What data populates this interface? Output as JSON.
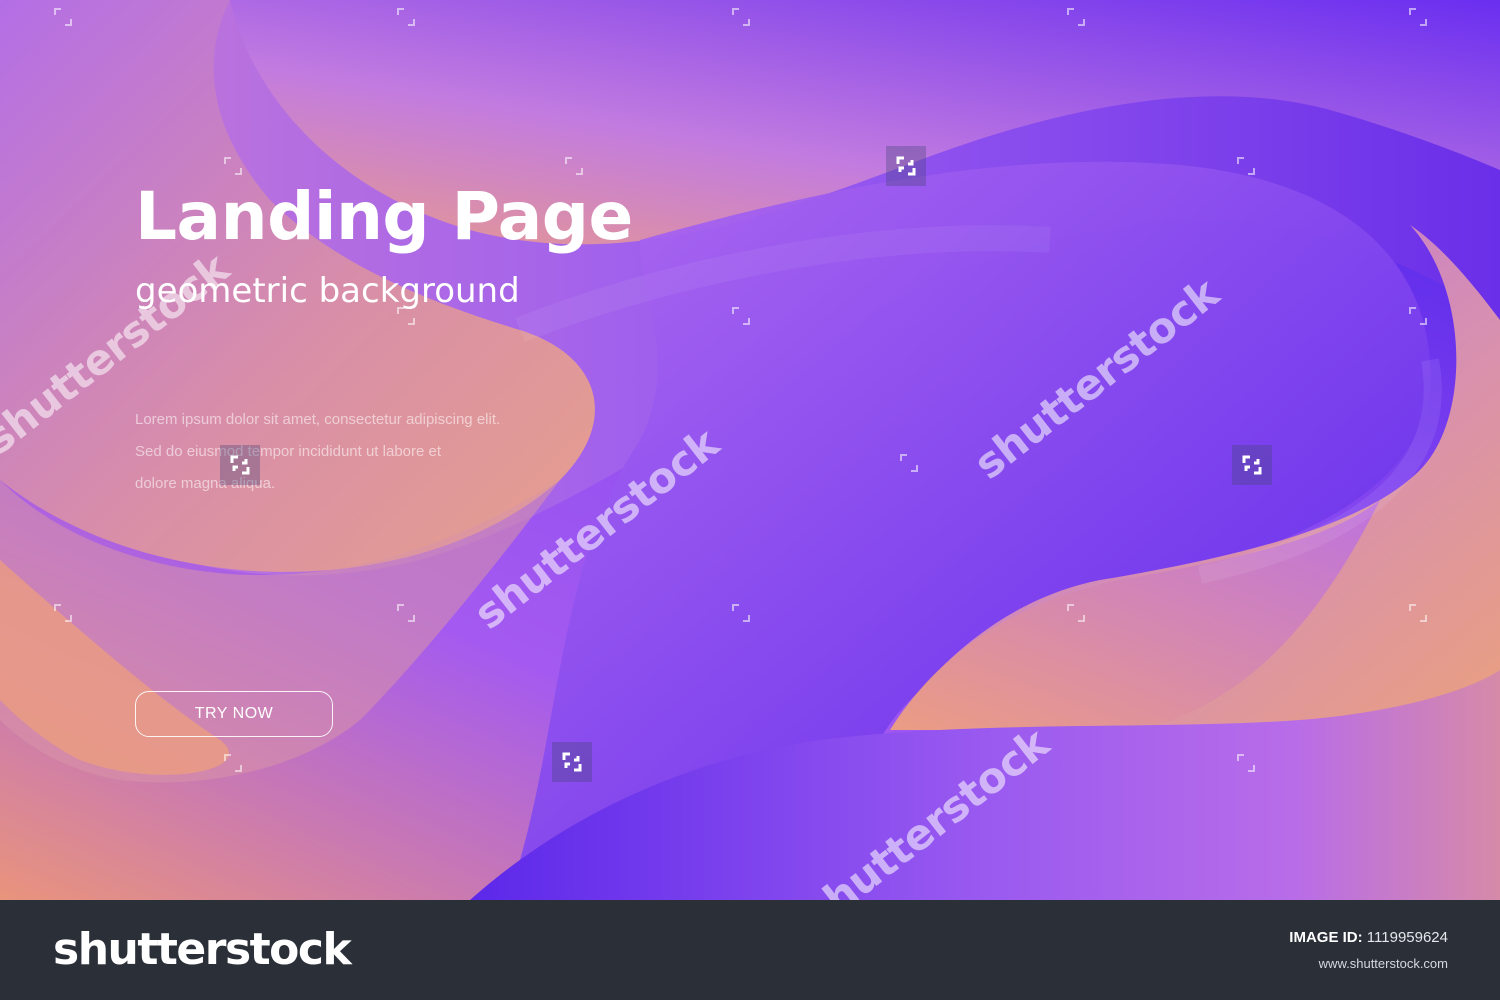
{
  "hero": {
    "title": "Landing Page",
    "subtitle": "geometric background",
    "body_lines": [
      "Lorem ipsum dolor sit amet, consectetur adipiscing elit.",
      "Sed do eiusmod tempor incididunt ut labore et",
      "dolore magna aliqua."
    ],
    "cta_label": "TRY NOW"
  },
  "watermark": {
    "text": "shutterstock",
    "icon": "shutterstock-watermark-icon"
  },
  "footer": {
    "logo": "shutterstock",
    "image_id_label": "IMAGE ID:",
    "image_id_value": "1119959624",
    "url": "www.shutterstock.com"
  },
  "colors": {
    "deep_violet": "#6128ea",
    "lavender": "#b86ce8",
    "peach": "#f0a07a",
    "footer_bg": "#2a2f38",
    "white": "#ffffff"
  }
}
